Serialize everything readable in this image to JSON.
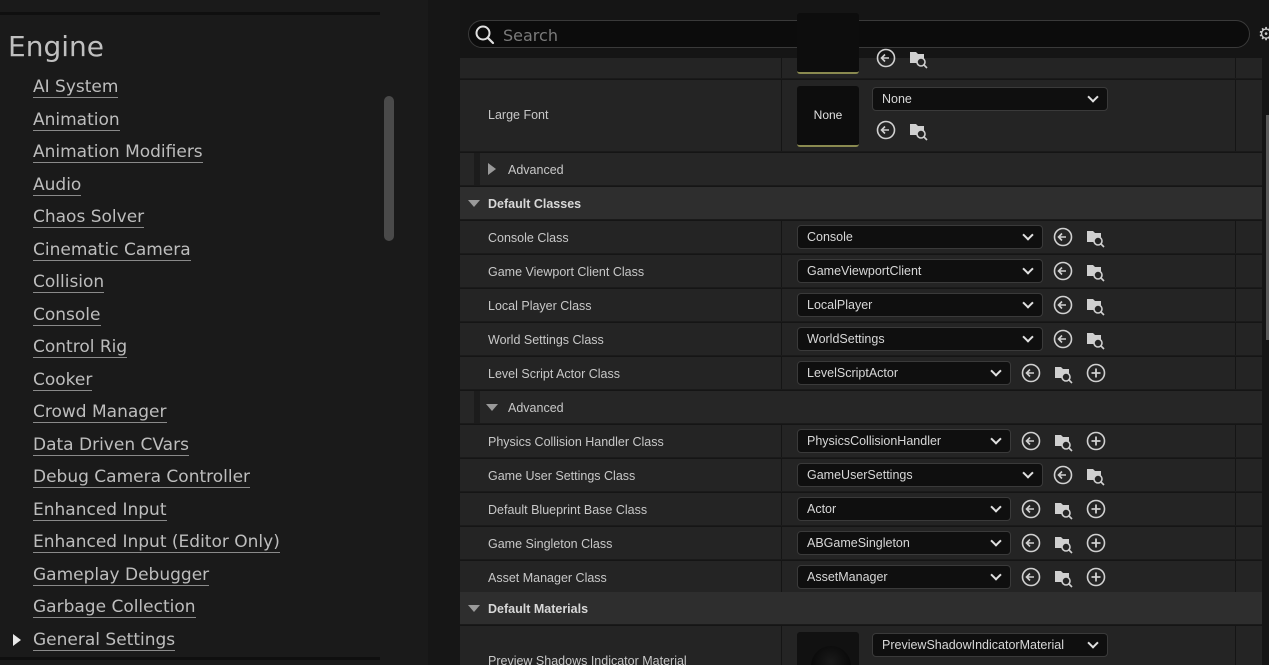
{
  "sidebar": {
    "section_title": "Engine",
    "items": [
      {
        "label": "AI System"
      },
      {
        "label": "Animation"
      },
      {
        "label": "Animation Modifiers"
      },
      {
        "label": "Audio"
      },
      {
        "label": "Chaos Solver"
      },
      {
        "label": "Cinematic Camera"
      },
      {
        "label": "Collision"
      },
      {
        "label": "Console"
      },
      {
        "label": "Control Rig"
      },
      {
        "label": "Cooker"
      },
      {
        "label": "Crowd Manager"
      },
      {
        "label": "Data Driven CVars"
      },
      {
        "label": "Debug Camera Controller"
      },
      {
        "label": "Enhanced Input"
      },
      {
        "label": "Enhanced Input (Editor Only)"
      },
      {
        "label": "Gameplay Debugger"
      },
      {
        "label": "Garbage Collection"
      },
      {
        "label": "General Settings",
        "expandable": true
      }
    ]
  },
  "search": {
    "placeholder": "Search"
  },
  "details": {
    "large_font": {
      "label": "Large Font",
      "thumb": "None",
      "value": "None"
    },
    "advanced_collapsed": "Advanced",
    "default_classes": {
      "title": "Default Classes",
      "rows": [
        {
          "label": "Console Class",
          "value": "Console"
        },
        {
          "label": "Game Viewport Client Class",
          "value": "GameViewportClient"
        },
        {
          "label": "Local Player Class",
          "value": "LocalPlayer"
        },
        {
          "label": "World Settings Class",
          "value": "WorldSettings"
        },
        {
          "label": "Level Script Actor Class",
          "value": "LevelScriptActor"
        }
      ],
      "advanced_label": "Advanced",
      "advanced_rows": [
        {
          "label": "Physics Collision Handler Class",
          "value": "PhysicsCollisionHandler"
        },
        {
          "label": "Game User Settings Class",
          "value": "GameUserSettings"
        },
        {
          "label": "Default Blueprint Base Class",
          "value": "Actor"
        },
        {
          "label": "Game Singleton Class",
          "value": "ABGameSingleton"
        },
        {
          "label": "Asset Manager Class",
          "value": "AssetManager"
        }
      ]
    },
    "default_materials": {
      "title": "Default Materials",
      "rows": [
        {
          "label": "Preview Shadows Indicator Material",
          "value": "PreviewShadowIndicatorMaterial"
        }
      ]
    }
  }
}
